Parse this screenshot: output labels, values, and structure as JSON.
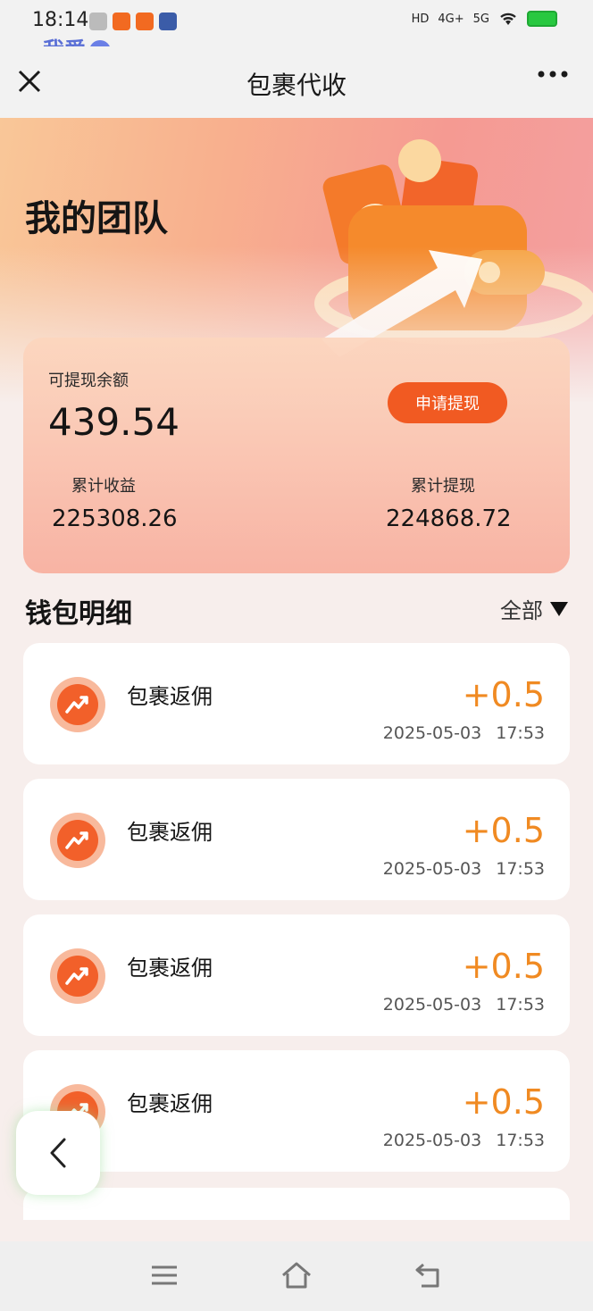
{
  "status_bar": {
    "time": "18:14",
    "network_labels": [
      "HD",
      "4G+",
      "5G"
    ],
    "watermark": "我爱"
  },
  "nav": {
    "title": "包裹代收",
    "close_icon": "close-icon",
    "more_icon": "more-icon"
  },
  "hero": {
    "title": "我的团队"
  },
  "balance": {
    "label": "可提现余额",
    "value": "439.54",
    "withdraw_button": "申请提现",
    "total_income_label": "累计收益",
    "total_income_value": "225308.26",
    "total_withdraw_label": "累计提现",
    "total_withdraw_value": "224868.72"
  },
  "wallet": {
    "title": "钱包明细",
    "filter_label": "全部",
    "items": [
      {
        "title": "包裹返佣",
        "amount": "+0.5",
        "date": "2025-05-03 17:53"
      },
      {
        "title": "包裹返佣",
        "amount": "+0.5",
        "date": "2025-05-03 17:53"
      },
      {
        "title": "包裹返佣",
        "amount": "+0.5",
        "date": "2025-05-03 17:53"
      },
      {
        "title": "包裹返佣",
        "amount": "+0.5",
        "date": "2025-05-03 17:53"
      }
    ]
  },
  "colors": {
    "accent": "#f15a22",
    "amount": "#f08a22",
    "icon_ring": "#f8b99c"
  }
}
